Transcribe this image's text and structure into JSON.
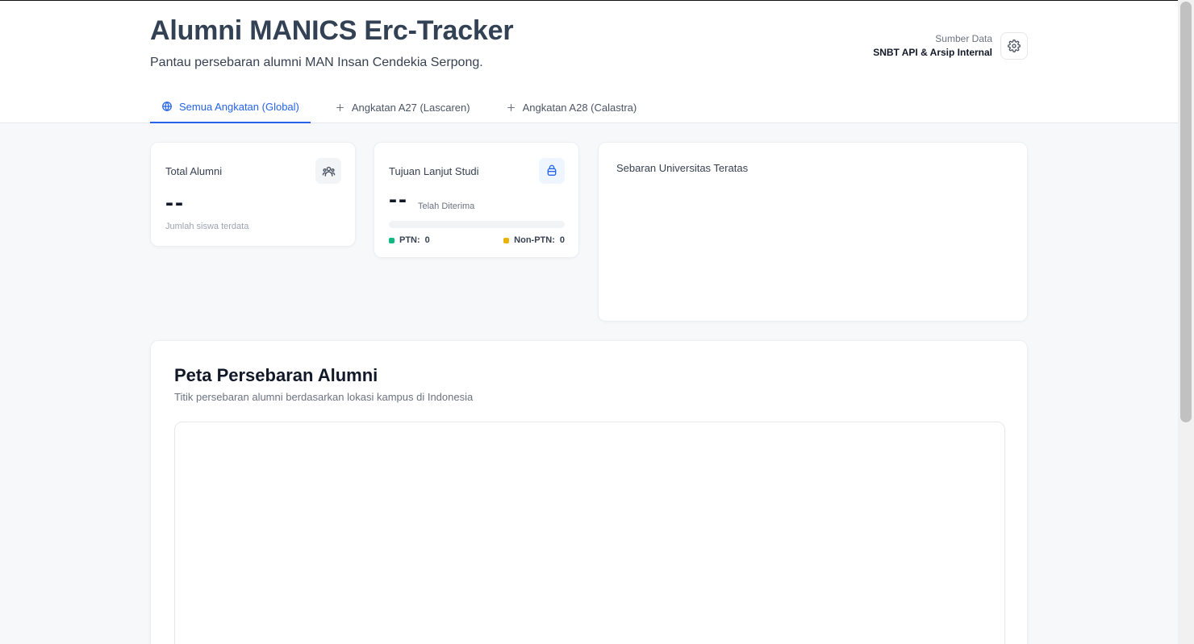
{
  "header": {
    "title": "Alumni MANICS Erc-Tracker",
    "subtitle": "Pantau persebaran alumni MAN Insan Cendekia Serpong.",
    "source_label": "Sumber Data",
    "source_value": "SNBT API & Arsip Internal",
    "settings_icon": "gear-icon"
  },
  "tabs": [
    {
      "label": "Semua Angkatan (Global)",
      "icon": "globe-icon",
      "active": true
    },
    {
      "label": "Angkatan A27 (Lascaren)",
      "icon": "plus-icon",
      "active": false
    },
    {
      "label": "Angkatan A28 (Calastra)",
      "icon": "plus-icon",
      "active": false
    }
  ],
  "stats": {
    "total_alumni": {
      "title": "Total Alumni",
      "value": "--",
      "note": "Jumlah siswa terdata",
      "icon": "users-icon"
    },
    "tujuan": {
      "title": "Tujuan Lanjut Studi",
      "value": "--",
      "note": "Telah Diterima",
      "icon": "bag-icon",
      "progress": 0,
      "ptn_label": "PTN:",
      "ptn_value": "0",
      "nonptn_label": "Non-PTN:",
      "nonptn_value": "0"
    },
    "sebaran": {
      "title": "Sebaran Universitas Teratas"
    }
  },
  "map": {
    "title": "Peta Persebaran Alumni",
    "subtitle": "Titik persebaran alumni berdasarkan lokasi kampus di Indonesia"
  },
  "colors": {
    "accent": "#2563eb",
    "ptn": "#10b981",
    "nonptn": "#eab308"
  }
}
